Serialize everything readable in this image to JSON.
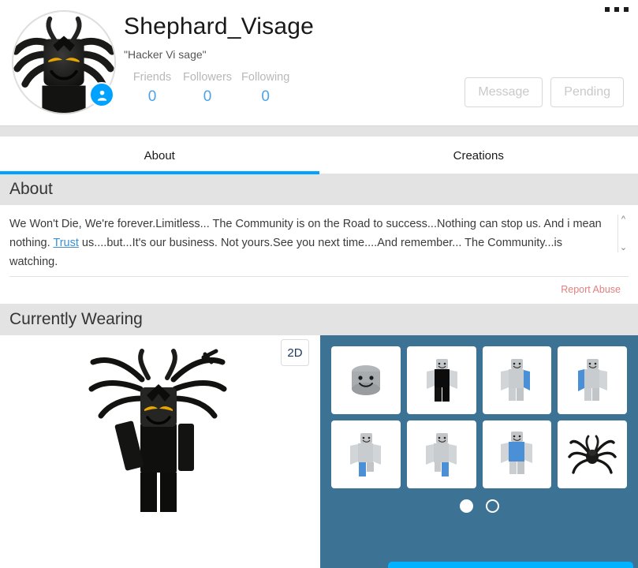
{
  "header": {
    "username": "Shephard_Visage",
    "blurb": "\"Hacker Vi sage\"",
    "menu_icon": "kebab-menu-icon",
    "presence_icon": "person-badge-icon",
    "stats": [
      {
        "label": "Friends",
        "value": "0"
      },
      {
        "label": "Followers",
        "value": "0"
      },
      {
        "label": "Following",
        "value": "0"
      }
    ],
    "actions": [
      {
        "name": "message-button",
        "label": "Message"
      },
      {
        "name": "pending-button",
        "label": "Pending"
      }
    ]
  },
  "tabs": [
    {
      "label": "About",
      "active": true
    },
    {
      "label": "Creations",
      "active": false
    }
  ],
  "about": {
    "section_title": "About",
    "description_part1": "We Won't Die, We're forever.Limitless... The Community is on the Road to success...Nothing can stop us. And i mean nothing. ",
    "description_link": "Trust",
    "description_part2": " us....but...It's our business. Not yours.See you next time....And remember... The Community...is watching.",
    "scroll_up_icon": "chevron-up-icon",
    "scroll_down_icon": "chevron-down-icon",
    "report_abuse": "Report Abuse"
  },
  "currently_wearing": {
    "section_title": "Currently Wearing",
    "view_toggle_label": "2D",
    "items": [
      {
        "name": "thumbnail-head-face",
        "kind": "head"
      },
      {
        "name": "thumbnail-black-shirt",
        "kind": "black-shirt"
      },
      {
        "name": "thumbnail-blue-right-arm",
        "kind": "arm-right"
      },
      {
        "name": "thumbnail-blue-left-arm",
        "kind": "arm-left"
      },
      {
        "name": "thumbnail-blue-right-leg",
        "kind": "leg-right"
      },
      {
        "name": "thumbnail-blue-left-leg",
        "kind": "leg-left"
      },
      {
        "name": "thumbnail-blue-torso",
        "kind": "torso"
      },
      {
        "name": "thumbnail-spider-accessory",
        "kind": "spider"
      }
    ],
    "pagination": {
      "total": 2,
      "current": 1
    }
  },
  "colors": {
    "accent_blue": "#00a2ff",
    "link_blue": "#4aa3ea",
    "panel_blue": "#3c7293",
    "report_red": "#e08080",
    "page_grey": "#e3e3e3",
    "bottom_accent": "#00b2ff"
  }
}
